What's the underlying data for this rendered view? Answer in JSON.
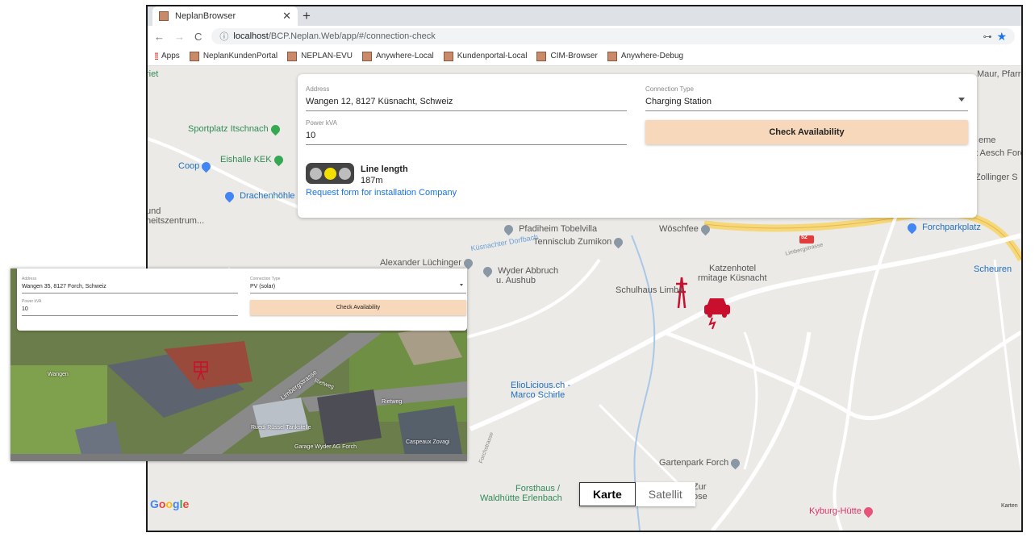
{
  "browser": {
    "tab_title": "NeplanBrowser",
    "url_host": "localhost",
    "url_path": "/BCP.Neplan.Web/app/#/connection-check",
    "bookmarks": [
      "Apps",
      "NeplanKundenPortal",
      "NEPLAN-EVU",
      "Anywhere-Local",
      "Kundenportal-Local",
      "CIM-Browser",
      "Anywhere-Debug"
    ]
  },
  "form": {
    "address_label": "Address",
    "address_value": "Wangen 12, 8127 Küsnacht, Schweiz",
    "connection_type_label": "Connection Type",
    "connection_type_value": "Charging Station",
    "power_label": "Power kVA",
    "power_value": "10",
    "check_button": "Check Availability",
    "line_length_title": "Line length",
    "line_length_value": "187m",
    "request_link": "Request form for installation Company"
  },
  "traffic_light": {
    "active": "yellow"
  },
  "map": {
    "labels": {
      "sportplatz": "Sportplatz Itschnach",
      "eishalle": "Eishalle KEK",
      "coop": "Coop",
      "drachenhoehle": "Drachenhöhle",
      "heitszentrum": "heitszentrum...",
      "und": "und",
      "pfadiheim": "Pfadiheim Tobelvilla",
      "tennisclub": "Tennisclub Zumikon",
      "alexander": "Alexander Lüchinger",
      "wyder1": "Wyder Abbruch",
      "wyder2": "u. Aushub",
      "woeschfee": "Wöschfee",
      "forchparkplatz": "Forchparkplatz",
      "katzenhotel": "Katzenhotel",
      "ermitage": "rmitage Küsnacht",
      "schulhaus": "Schulhaus Limbe",
      "scheuren": "Scheuren",
      "eliolicious1": "ElioLicious.ch -",
      "eliolicious2": "Marco Schirle",
      "gartenpark": "Gartenpark Forch",
      "forsthaus1": "Forsthaus /",
      "forsthaus2": "Waldhütte Erlenbach",
      "zur": "Zur",
      "ose": "ose",
      "kyburg": "Kyburg-Hütte",
      "maur": "Maur, Pfarreri",
      "eme": "eme",
      "aesch": "t Aesch Forc",
      "zollinger": "Zollinger S",
      "riet": "riet",
      "limbergstrasse": "Limbergstrasse",
      "dorfbach": "Küsnachter Dorfbach",
      "forchstrasse": "Forchstrasse",
      "road52": "52",
      "kartendaten": "Karten"
    },
    "map_type_buttons": [
      "Karte",
      "Satellit"
    ],
    "google_logo": "Google"
  },
  "inset": {
    "address_label": "Address",
    "address_value": "Wangen 35, 8127 Forch, Schweiz",
    "connection_type_label": "Connection Type",
    "connection_type_value": "PV (solar)",
    "power_label": "Power kVA",
    "power_value": "10",
    "check_button": "Check Availability",
    "labels": {
      "wangen": "Wangen",
      "limbergstrasse": "Limbergstrasse",
      "rietweg1": "Rietweg",
      "rietweg2": "Rietweg",
      "tankstelle": "Ruedi Rüssel Tankstelle",
      "garage": "Garage Wyder AG Forch",
      "caspeaux": "Caspeaux Zovagi"
    }
  },
  "colors": {
    "accent_button": "#f8d8bb",
    "link": "#1a73e8",
    "marker_red": "#c8102e",
    "highway": "#f6d77a"
  }
}
